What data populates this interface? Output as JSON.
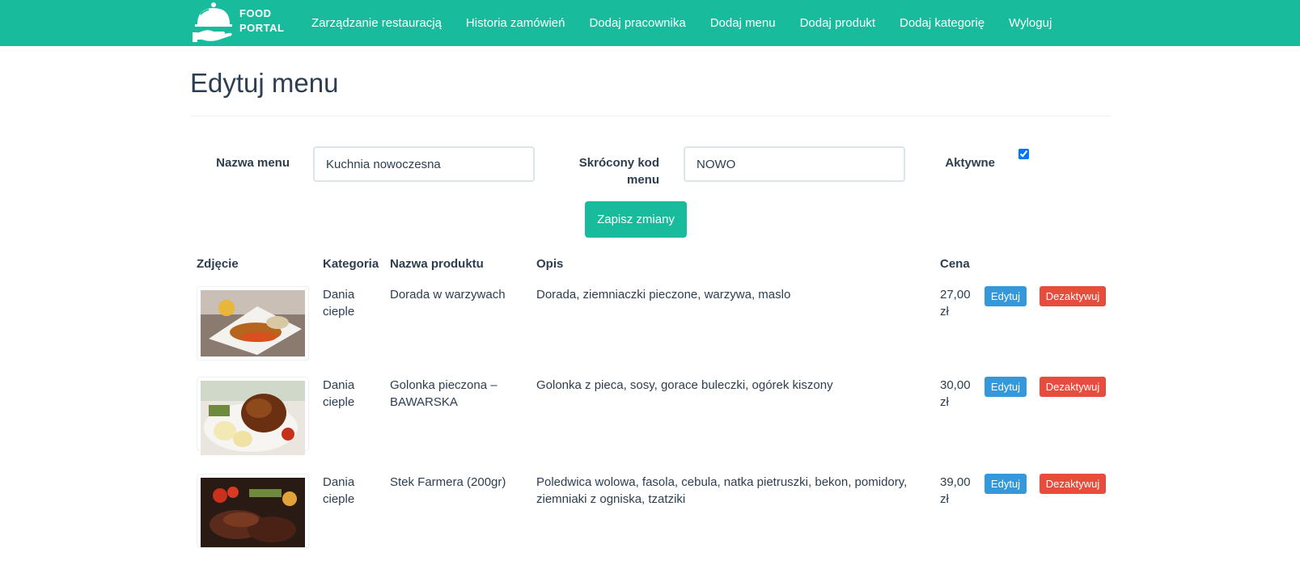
{
  "nav": {
    "logo_line1": "FOOD",
    "logo_line2": "PORTAL",
    "logo_icon": "cloche-icon",
    "items": [
      "Zarządzanie restauracją",
      "Historia zamówień",
      "Dodaj pracownika",
      "Dodaj menu",
      "Dodaj produkt",
      "Dodaj kategorię",
      "Wyloguj"
    ]
  },
  "page": {
    "title": "Edytuj menu"
  },
  "form": {
    "menu_name_label": "Nazwa menu",
    "menu_name_value": "Kuchnia nowoczesna",
    "short_code_label_line1": "Skrócony kod",
    "short_code_label_line2": "menu",
    "short_code_value": "NOWO",
    "active_label": "Aktywne",
    "active_checked": true,
    "save_label": "Zapisz zmiany"
  },
  "table": {
    "headers": {
      "photo": "Zdjęcie",
      "category": "Kategoria",
      "name": "Nazwa produktu",
      "description": "Opis",
      "price": "Cena"
    },
    "rows": [
      {
        "category_line1": "Dania",
        "category_line2": "cieple",
        "name_line1": "Dorada w warzywach",
        "name_line2": "",
        "description_line1": "Dorada, ziemniaczki pieczone, warzywa, maslo",
        "description_line2": "",
        "price_line1": "27,00",
        "price_line2": "zł",
        "edit_label": "Edytuj",
        "deactivate_label": "Dezaktywuj"
      },
      {
        "category_line1": "Dania",
        "category_line2": "cieple",
        "name_line1": "Golonka pieczona –",
        "name_line2": "BAWARSKA",
        "description_line1": "Golonka z pieca, sosy, gorace buleczki, ogórek kiszony",
        "description_line2": "",
        "price_line1": "30,00",
        "price_line2": "zł",
        "edit_label": "Edytuj",
        "deactivate_label": "Dezaktywuj"
      },
      {
        "category_line1": "Dania",
        "category_line2": "cieple",
        "name_line1": "Stek Farmera (200gr)",
        "name_line2": "",
        "description_line1": "Poledwica wolowa, fasola, cebula, natka pietruszki, bekon, pomidory,",
        "description_line2": "ziemniaki z ogniska, tzatziki",
        "price_line1": "39,00",
        "price_line2": "zł",
        "edit_label": "Edytuj",
        "deactivate_label": "Dezaktywuj"
      }
    ]
  },
  "colors": {
    "brand": "#18bc9c",
    "text": "#2c3e50",
    "edit": "#3498db",
    "deactivate": "#e74c3c"
  }
}
